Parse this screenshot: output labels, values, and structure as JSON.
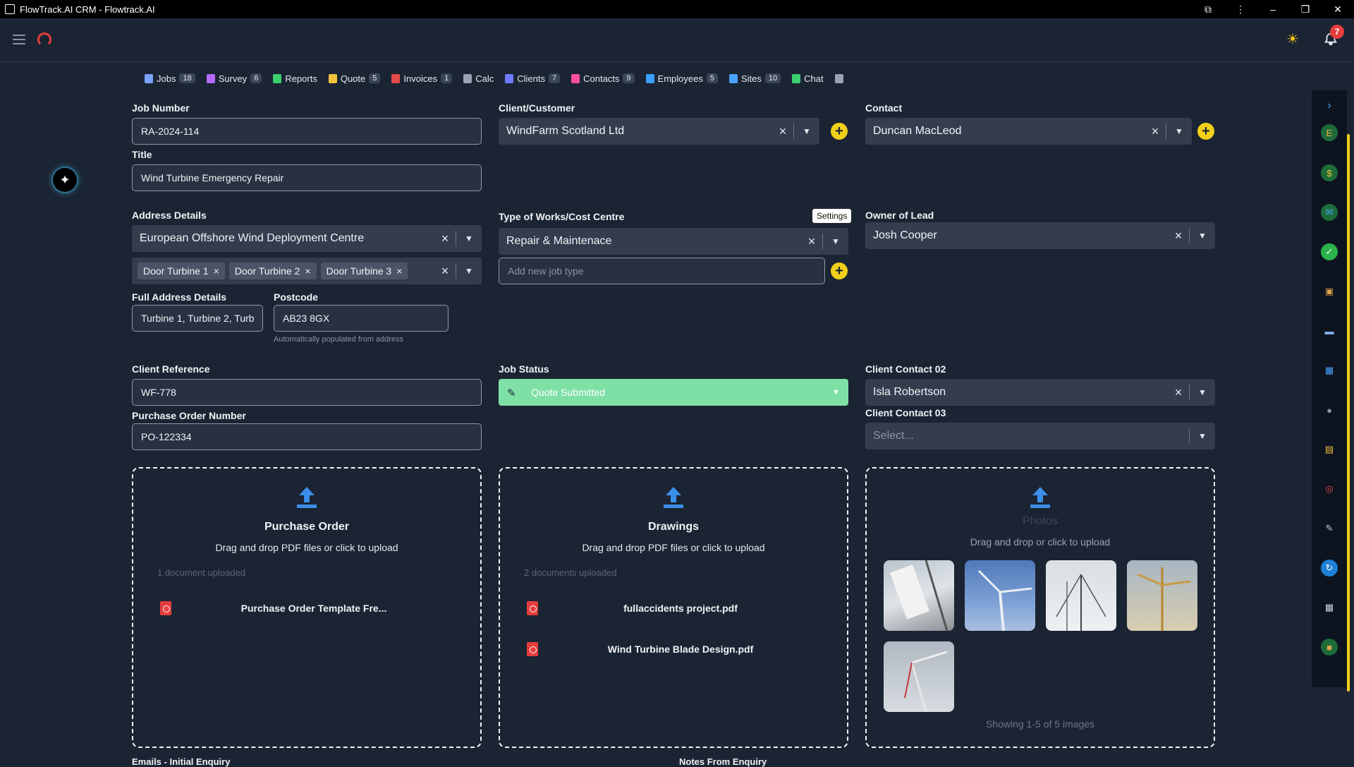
{
  "window": {
    "title": "FlowTrack.AI CRM - Flowtrack.AI",
    "minimize": "–",
    "maximize": "❐",
    "close": "✕",
    "menu": "⋮",
    "ext": "⧉"
  },
  "header": {
    "notification_count": "7"
  },
  "tabs": [
    {
      "label": "Jobs",
      "count": "18",
      "color": "#7aa2ff"
    },
    {
      "label": "Survey",
      "count": "6",
      "color": "#b56cff"
    },
    {
      "label": "Reports",
      "count": "",
      "color": "#3ccf6e"
    },
    {
      "label": "Quote",
      "count": "5",
      "color": "#f2c33c"
    },
    {
      "label": "Invoices",
      "count": "1",
      "color": "#e54a4a"
    },
    {
      "label": "Calc",
      "count": "",
      "color": "#9aa3b2"
    },
    {
      "label": "Clients",
      "count": "7",
      "color": "#6f7bff"
    },
    {
      "label": "Contacts",
      "count": "9",
      "color": "#ff4fa0"
    },
    {
      "label": "Employees",
      "count": "5",
      "color": "#3a9fff"
    },
    {
      "label": "Sites",
      "count": "10",
      "color": "#4aa3ff"
    },
    {
      "label": "Chat",
      "count": "",
      "color": "#3ccf6e"
    },
    {
      "label": "",
      "count": "",
      "color": "#9aa3b2"
    }
  ],
  "form": {
    "job_number_label": "Job Number",
    "job_number": "RA-2024-114",
    "title_label": "Title",
    "title": "Wind Turbine Emergency Repair",
    "client_label": "Client/Customer",
    "client": "WindFarm Scotland Ltd",
    "contact_label": "Contact",
    "contact": "Duncan MacLeod",
    "address_label": "Address Details",
    "address": "European Offshore Wind Deployment Centre",
    "address_chips": [
      "Door Turbine 1",
      "Door Turbine 2",
      "Door Turbine 3"
    ],
    "full_address_label": "Full Address Details",
    "full_address": "Turbine 1, Turbine 2, Turb",
    "postcode_label": "Postcode",
    "postcode": "AB23 8GX",
    "postcode_hint": "Automatically populated from address",
    "works_label": "Type of Works/Cost Centre",
    "works": "Repair & Maintenace",
    "works_placeholder": "Add new job type",
    "settings_tooltip": "Settings",
    "owner_label": "Owner of Lead",
    "owner": "Josh Cooper",
    "client_ref_label": "Client Reference",
    "client_ref": "WF-778",
    "po_label": "Purchase Order Number",
    "po": "PO-122334",
    "status_label": "Job Status",
    "status": "Quote Submitted",
    "status_color": "#7fe0a6",
    "contact02_label": "Client Contact 02",
    "contact02": "Isla Robertson",
    "contact03_label": "Client Contact 03",
    "contact03_placeholder": "Select..."
  },
  "uploads": {
    "purchase_order": {
      "title": "Purchase Order",
      "subtitle": "Drag and drop PDF files or click to upload",
      "count": "1 document uploaded",
      "files": [
        "Purchase Order Template Fre..."
      ]
    },
    "drawings": {
      "title": "Drawings",
      "subtitle": "Drag and drop PDF files or click to upload",
      "count": "2 documents uploaded",
      "files": [
        "fullaccidents project.pdf",
        "Wind Turbine Blade Design.pdf"
      ]
    },
    "photos": {
      "title": "Photos",
      "subtitle": "Drag and drop or click to upload",
      "footer": "Showing 1-5 of 5 images",
      "count_shown": 5
    }
  },
  "bottom": {
    "emails_label": "Emails - Initial Enquiry",
    "notes_label": "Notes From Enquiry"
  },
  "accent": {
    "yellow": "#f2d019",
    "upload_blue": "#3b8fe8",
    "pdf_red": "#e53d3d"
  }
}
